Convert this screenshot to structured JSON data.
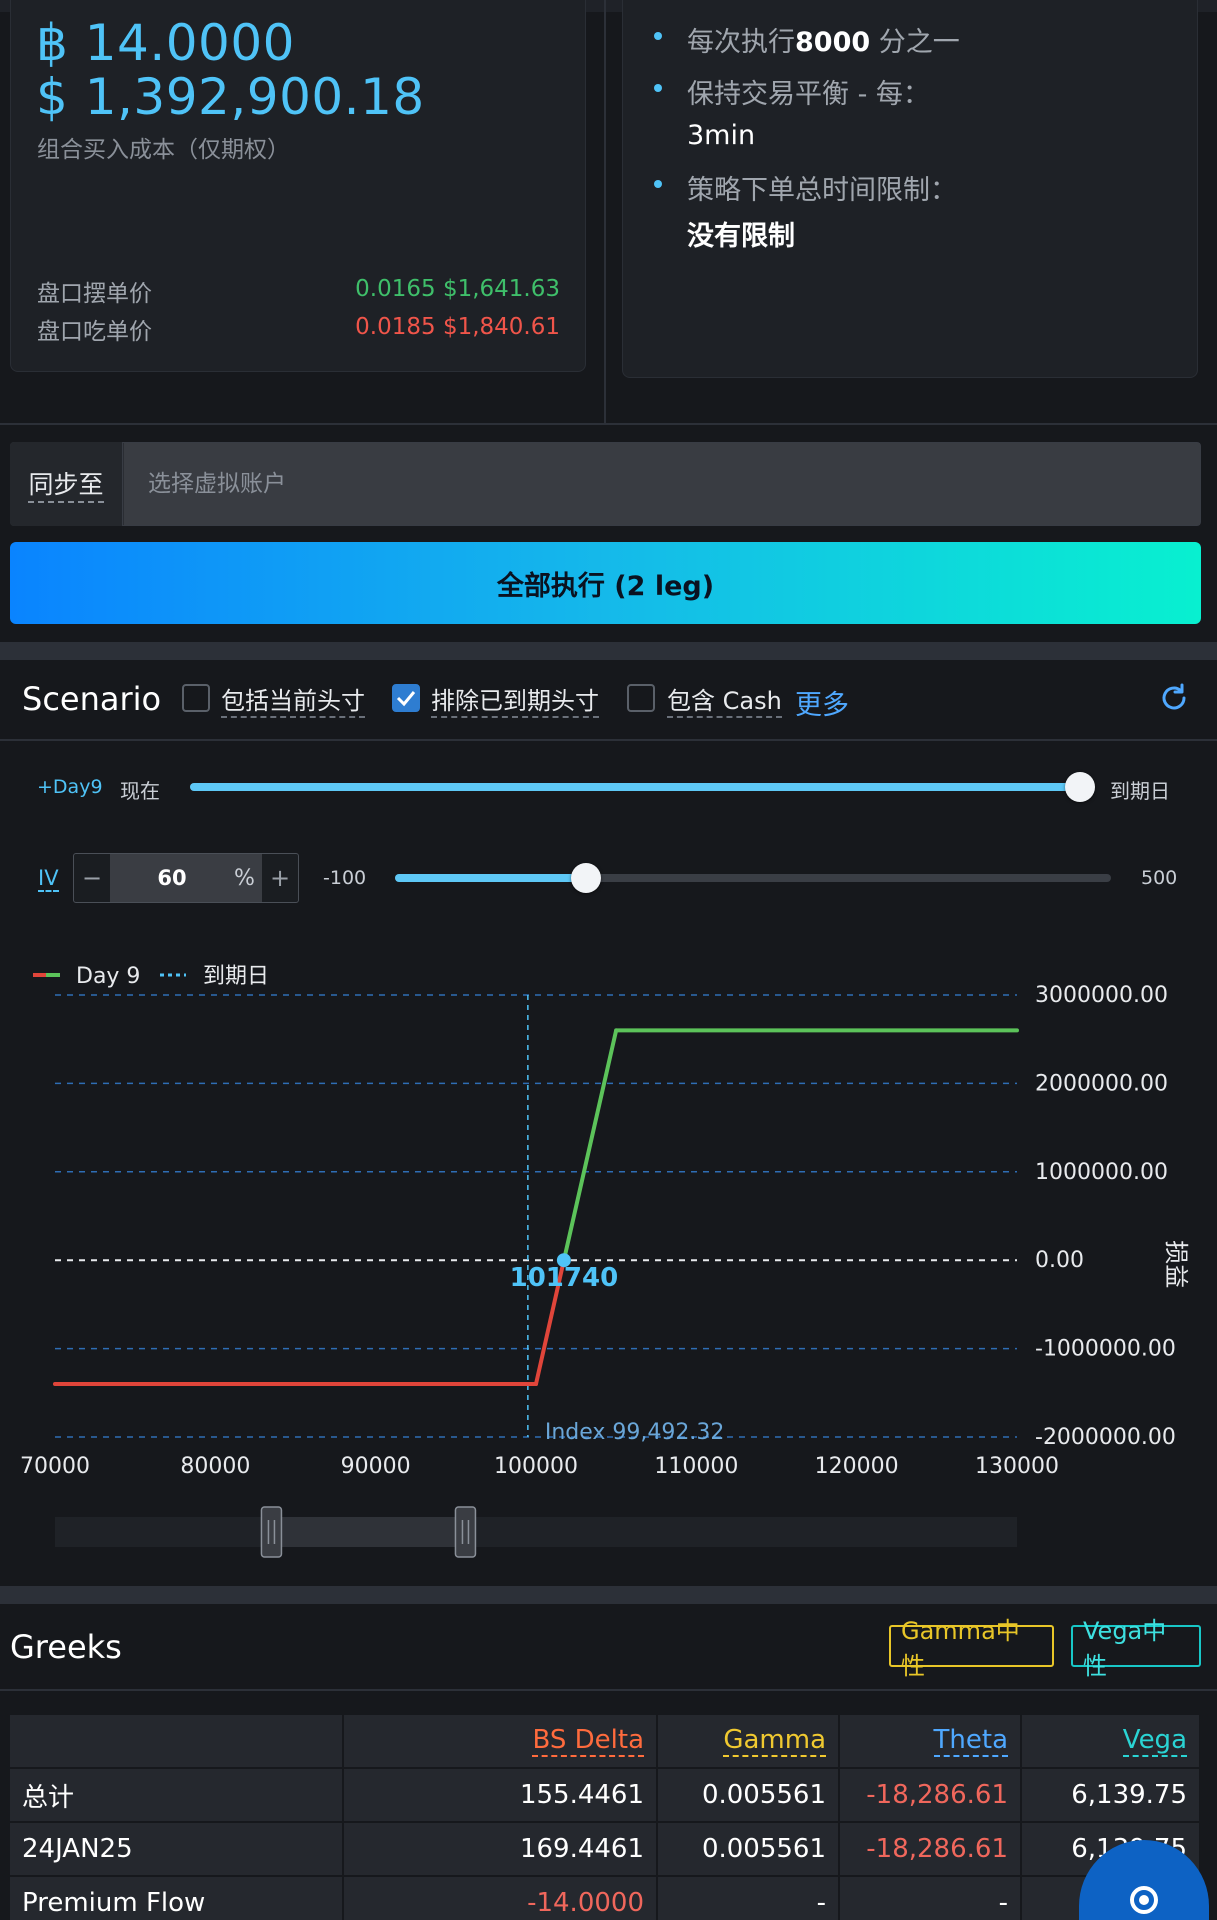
{
  "summary": {
    "btc_symbol": "฿",
    "btc_amount": "14.0000",
    "usd_symbol": "$",
    "usd_amount": "1,392,900.18",
    "cost_label": "组合买入成本（仅期权）",
    "maker_label": "盘口摆单价",
    "maker_value": "0.0165 $1,641.63",
    "taker_label": "盘口吃单价",
    "taker_value": "0.0185 $1,840.61"
  },
  "info": {
    "line1_prefix": "每次执行",
    "line1_num": "8000",
    "line1_suffix": " 分之一",
    "line2_label": "保持交易平衡 - 每：",
    "line2_value": "3min",
    "line3_label": "策略下单总时间限制：",
    "line3_value": "没有限制"
  },
  "sync": {
    "label": "同步至",
    "placeholder": "选择虚拟账户"
  },
  "execute_button": "全部执行 (2 leg)",
  "scenario": {
    "title": "Scenario",
    "cb_include_current": "包括当前头寸",
    "cb_exclude_expired": "排除已到期头寸",
    "cb_include_cash": "包含 Cash",
    "more": "更多",
    "day_tag": "+Day9",
    "now_label": "现在",
    "expiry_label": "到期日",
    "day_progress": 1.0,
    "iv_label": "IV",
    "iv_value": "60",
    "iv_unit": "%",
    "iv_min": "-100",
    "iv_max": "500",
    "iv_slider_value": 60
  },
  "chart_data": {
    "type": "line",
    "legend": [
      "Day 9",
      "到期日"
    ],
    "ylabel": "损益",
    "x_ticks": [
      "70000",
      "80000",
      "90000",
      "100000",
      "110000",
      "120000",
      "130000"
    ],
    "y_ticks": [
      "3000000.00",
      "2000000.00",
      "1000000.00",
      "0.00",
      "-1000000.00",
      "-2000000.00"
    ],
    "xlim": [
      70000,
      130000
    ],
    "ylim": [
      -2000000,
      3000000
    ],
    "series": [
      {
        "name": "Day 9",
        "points": [
          [
            70000,
            -1400000
          ],
          [
            100000,
            -1400000
          ],
          [
            101740,
            0
          ],
          [
            105000,
            2600000
          ],
          [
            130000,
            2600000
          ]
        ]
      }
    ],
    "breakeven_label": "101740",
    "breakeven_x": 101740,
    "index_label": "Index 99,492.32",
    "index_x": 99492.32,
    "range_window": [
      83500,
      95600
    ],
    "colors": {
      "loss": "#e0453a",
      "profit": "#5cc35a",
      "accent": "#4fc3f7"
    }
  },
  "greeks": {
    "title": "Greeks",
    "tag_gamma": "Gamma中性",
    "tag_vega": "Vega中性",
    "headers": [
      "",
      "BS Delta",
      "Gamma",
      "Theta",
      "Vega"
    ],
    "rows": [
      [
        "总计",
        "155.4461",
        "0.005561",
        "-18,286.61",
        "6,139.75"
      ],
      [
        "24JAN25",
        "169.4461",
        "0.005561",
        "-18,286.61",
        "6,139.75"
      ],
      [
        "Premium Flow",
        "-14.0000",
        "-",
        "-",
        ""
      ]
    ]
  }
}
